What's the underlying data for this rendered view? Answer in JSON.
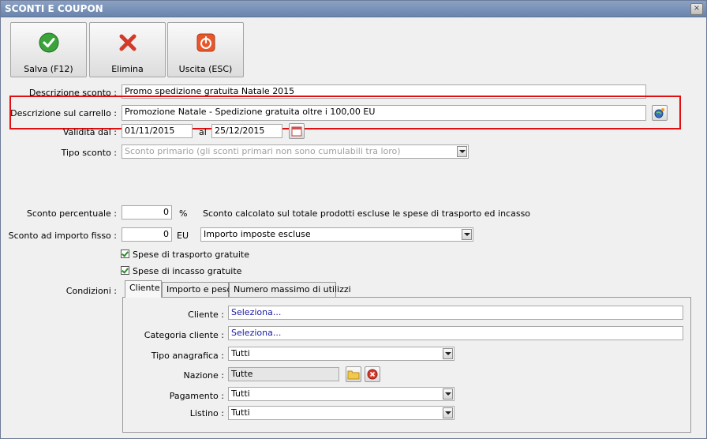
{
  "window": {
    "title": "SCONTI E COUPON",
    "close_glyph": "×"
  },
  "toolbar": {
    "save_label": "Salva (F12)",
    "delete_label": "Elimina",
    "exit_label": "Uscita (ESC)"
  },
  "form": {
    "descrizione_sconto_label": "Descrizione sconto :",
    "descrizione_sconto_value": "Promo spedizione gratuita Natale 2015",
    "descrizione_carrello_label": "Descrizione sul carrello :",
    "descrizione_carrello_value": "Promozione Natale - Spedizione gratuita oltre i 100,00 EU",
    "validita_label": "Validità dal :",
    "validita_from": "01/11/2015",
    "al_label": "al",
    "validita_to": "25/12/2015",
    "tipo_sconto_label": "Tipo sconto :",
    "tipo_sconto_value": "Sconto primario (gli sconti primari non sono cumulabili tra loro)",
    "sconto_percentuale_label": "Sconto percentuale :",
    "sconto_percentuale_value": "0",
    "percent_unit": "%",
    "sconto_percentuale_note": "Sconto calcolato sul totale prodotti escluse le spese di trasporto ed incasso",
    "sconto_fisso_label": "Sconto ad importo fisso :",
    "sconto_fisso_value": "0",
    "currency_unit": "EU",
    "imposte_value": "Importo imposte escluse",
    "spese_trasporto_label": "Spese di trasporto gratuite",
    "spese_incasso_label": "Spese di incasso gratuite",
    "condizioni_label": "Condizioni :"
  },
  "tabs": [
    {
      "label": "Cliente"
    },
    {
      "label": "Importo e peso"
    },
    {
      "label": "Numero massimo di utilizzi"
    }
  ],
  "cliente_tab": {
    "cliente_label": "Cliente :",
    "cliente_value": "Seleziona...",
    "categoria_label": "Categoria cliente :",
    "categoria_value": "Seleziona...",
    "tipo_anagrafica_label": "Tipo anagrafica :",
    "tipo_anagrafica_value": "Tutti",
    "nazione_label": "Nazione :",
    "nazione_value": "Tutte",
    "pagamento_label": "Pagamento :",
    "pagamento_value": "Tutti",
    "listino_label": "Listino :",
    "listino_value": "Tutti"
  },
  "icons": {
    "save": "check-icon",
    "delete": "x-icon",
    "exit": "power-icon",
    "globe": "globe-icon",
    "calendar": "calendar-icon",
    "folder": "folder-icon",
    "clear": "clear-icon"
  },
  "colors": {
    "highlight": "#e01010",
    "titlebar": "#7890b8",
    "link_text": "#1a1aa8"
  }
}
